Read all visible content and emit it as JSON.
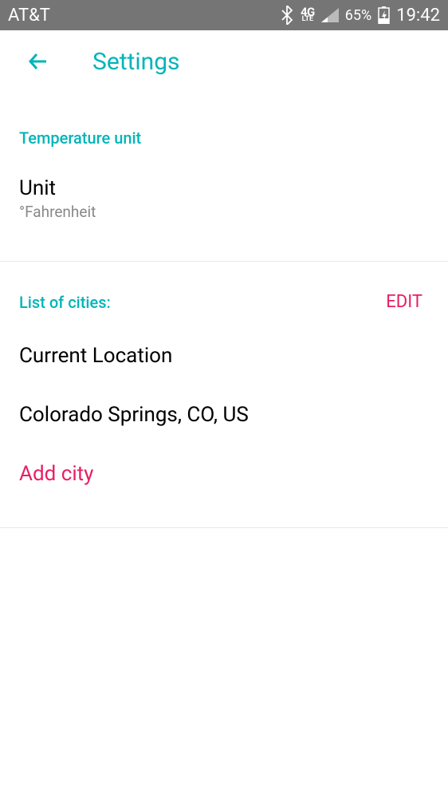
{
  "statusBar": {
    "carrier": "AT&T",
    "network": {
      "top": "4G",
      "bottom": "LTE"
    },
    "batteryPct": "65%",
    "time": "19:42"
  },
  "appBar": {
    "title": "Settings"
  },
  "tempSection": {
    "header": "Temperature unit",
    "label": "Unit",
    "value": "°Fahrenheit"
  },
  "citiesSection": {
    "header": "List of cities:",
    "editLabel": "EDIT",
    "items": [
      {
        "name": "Current Location"
      },
      {
        "name": "Colorado Springs, CO, US"
      }
    ],
    "addLabel": "Add city"
  }
}
